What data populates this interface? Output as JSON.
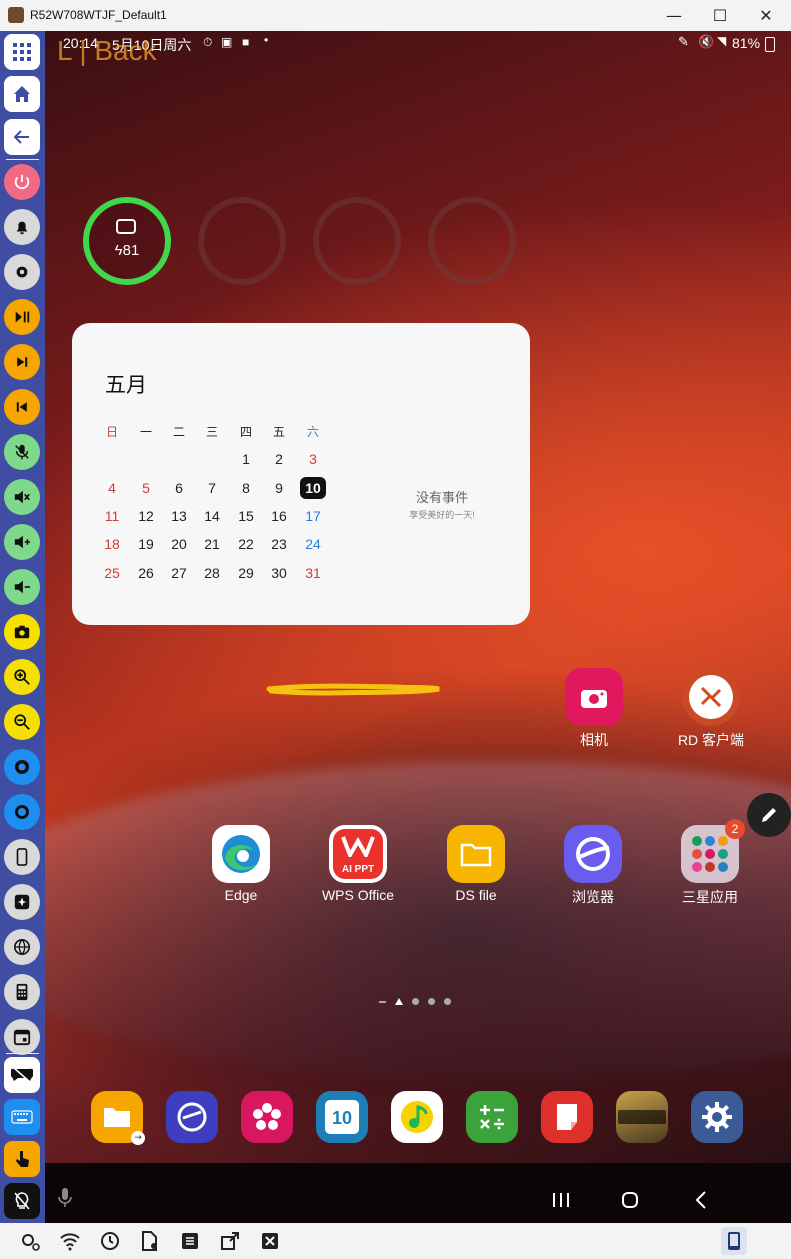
{
  "window": {
    "title": "R52W708WTJF_Default1",
    "minimize": "—",
    "maximize": "☐",
    "close": "✕"
  },
  "status": {
    "time": "20:14",
    "date": "5月10日周六",
    "battery": "81%"
  },
  "overlay_text": "L | Back",
  "battery_widget": {
    "value": "81"
  },
  "calendar": {
    "month": "五月",
    "weekdays": [
      "日",
      "一",
      "二",
      "三",
      "四",
      "五",
      "六"
    ],
    "rows": [
      [
        "",
        "",
        "",
        "",
        "1",
        "2",
        "3"
      ],
      [
        "4",
        "5",
        "6",
        "7",
        "8",
        "9",
        "10"
      ],
      [
        "11",
        "12",
        "13",
        "14",
        "15",
        "16",
        "17"
      ],
      [
        "18",
        "19",
        "20",
        "21",
        "22",
        "23",
        "24"
      ],
      [
        "25",
        "26",
        "27",
        "28",
        "29",
        "30",
        "31"
      ]
    ],
    "today": "10",
    "no_events": "没有事件",
    "no_events_sub": "享受美好的一天!"
  },
  "apps_row1": [
    {
      "label": "相机",
      "icon": "camera-icon",
      "color": "#e0195e"
    },
    {
      "label": "RD 客户端",
      "icon": "remote-desktop-icon",
      "color": "#c94a24"
    }
  ],
  "apps_row2": [
    {
      "label": "Edge",
      "icon": "edge-icon"
    },
    {
      "label": "WPS Office",
      "icon": "wps-icon",
      "sub": "AI PPT"
    },
    {
      "label": "DS file",
      "icon": "folder-icon"
    },
    {
      "label": "浏览器",
      "icon": "browser-icon"
    },
    {
      "label": "三星应用",
      "icon": "app-folder-icon",
      "badge": "2"
    }
  ],
  "dock_icons": [
    "my-files-icon",
    "samsung-notes-icon",
    "gallery-icon",
    "calendar-icon",
    "qq-music-icon",
    "calculator-icon",
    "notes-icon",
    "call-of-duty-icon",
    "settings-icon"
  ],
  "dock_calendar_day": "10",
  "sidebar_icons": [
    "apps-grid-icon",
    "home-icon",
    "back-icon",
    "power-icon",
    "notification-icon",
    "settings-icon",
    "play-pause-icon",
    "next-track-icon",
    "previous-track-icon",
    "mic-mute-icon",
    "volume-mute-icon",
    "volume-up-icon",
    "volume-down-icon",
    "screenshot-icon",
    "zoom-in-icon",
    "zoom-out-icon",
    "brightness-up-icon",
    "brightness-down-icon",
    "rotate-icon",
    "ai-icon",
    "globe-icon",
    "calculator-icon",
    "calendar-icon",
    "gamepad-icon",
    "keyboard-icon",
    "touch-icon",
    "light-off-icon"
  ],
  "colors": {
    "sidebar": "#3f4ea3",
    "accent_yellow": "#f5c211",
    "battery_green": "#3fd84a"
  }
}
